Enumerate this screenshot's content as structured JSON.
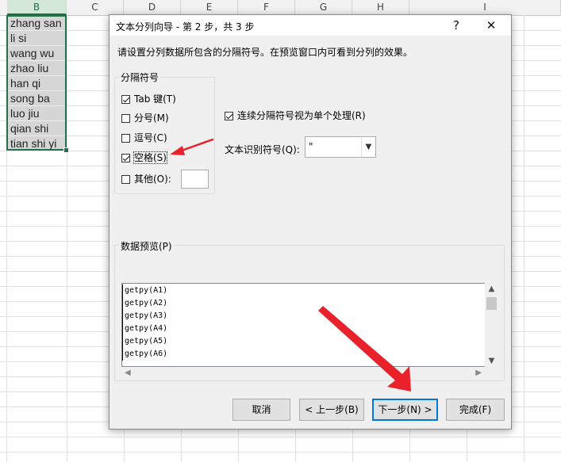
{
  "spreadsheet": {
    "columns": [
      "B",
      "C",
      "D",
      "E",
      "F",
      "G",
      "H",
      "I"
    ],
    "selected_column": "B",
    "cells_b": [
      "zhang san",
      "li si",
      "wang wu",
      "zhao liu",
      "han qi",
      "song ba",
      "luo jiu",
      "qian shi",
      "tian shi yi"
    ]
  },
  "dialog": {
    "title": "文本分列向导 - 第 2 步，共 3 步",
    "help_label": "?",
    "close_label": "✕",
    "instruction": "请设置分列数据所包含的分隔符号。在预览窗口内可看到分列的效果。",
    "delimiters_group_label": "分隔符号",
    "delimiters": [
      {
        "label": "Tab 键(T)",
        "checked": true
      },
      {
        "label": "分号(M)",
        "checked": false
      },
      {
        "label": "逗号(C)",
        "checked": false
      },
      {
        "label": "空格(S)",
        "checked": true
      },
      {
        "label": "其他(O):",
        "checked": false
      }
    ],
    "consecutive_label": "连续分隔符号视为单个处理(R)",
    "consecutive_checked": true,
    "text_qualifier_label": "文本识别符号(Q):",
    "text_qualifier_value": "\"",
    "preview_label": "数据预览(P)",
    "preview_lines": [
      "getpy(A1)",
      "getpy(A2)",
      "getpy(A3)",
      "getpy(A4)",
      "getpy(A5)",
      "getpy(A6)"
    ],
    "buttons": {
      "cancel": "取消",
      "back": "< 上一步(B)",
      "next": "下一步(N) >",
      "finish": "完成(F)"
    }
  },
  "colors": {
    "excel_green": "#217346",
    "annotation_red": "#e8212a",
    "focus_blue": "#0078d7"
  }
}
